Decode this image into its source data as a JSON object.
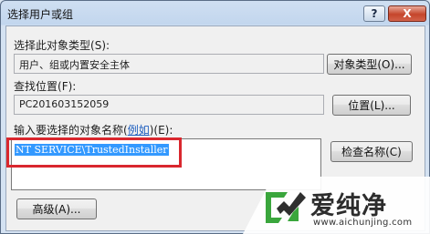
{
  "window": {
    "title": "选择用户或组",
    "help_label": "?",
    "close_label": "X"
  },
  "object_type": {
    "label_text": "选择此对象类型",
    "label_hotkey": "(S):",
    "value": "用户、组或内置安全主体",
    "button_label": "对象类型(O)..."
  },
  "location": {
    "label_text": "查找位置",
    "label_hotkey": "(F):",
    "value": "PC201603152059",
    "button_label": "位置(L)..."
  },
  "names": {
    "label_text": "输入要选择的对象名称(",
    "label_link": "例如",
    "label_hotkey": ")(E):",
    "value": "NT SERVICE\\TrustedInstaller",
    "check_button_label": "检查名称(C)"
  },
  "advanced_button_label": "高级(A)...",
  "watermark": {
    "brand": "爱纯净",
    "url": "www.aichunjing.com",
    "accent_color": "#3aa63c"
  },
  "colors": {
    "highlight_border": "#d9272e",
    "selection_bg": "#3399ff"
  }
}
